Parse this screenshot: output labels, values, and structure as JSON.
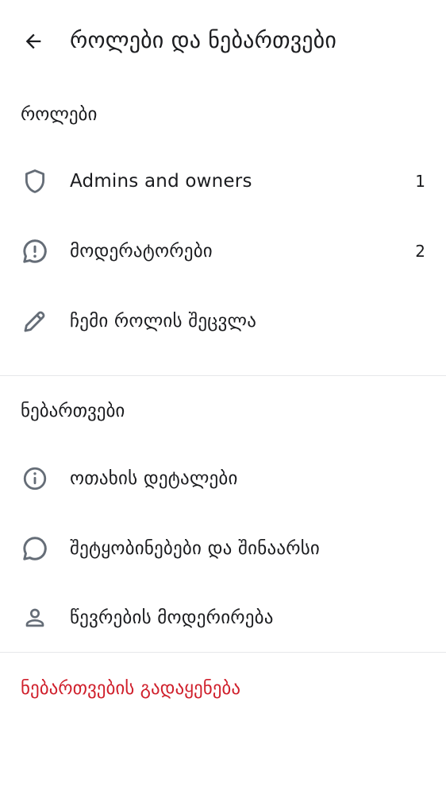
{
  "header": {
    "title": "როლები და ნებართვები",
    "back_icon": "arrow-left-icon"
  },
  "roles_section": {
    "title": "როლები",
    "items": [
      {
        "icon": "shield-icon",
        "label": "Admins and owners",
        "count": "1"
      },
      {
        "icon": "alert-chat-icon",
        "label": "მოდერატორები",
        "count": "2"
      },
      {
        "icon": "pencil-icon",
        "label": "ჩემი როლის შეცვლა"
      }
    ]
  },
  "permissions_section": {
    "title": "ნებართვები",
    "items": [
      {
        "icon": "info-icon",
        "label": "ოთახის დეტალები"
      },
      {
        "icon": "chat-bubble-icon",
        "label": "შეტყობინებები და შინაარსი"
      },
      {
        "icon": "person-icon",
        "label": "წევრების მოდერირება"
      }
    ]
  },
  "reset_label": "ნებართვების გადაყენება",
  "colors": {
    "text": "#1b1c1f",
    "icon": "#656d77",
    "danger": "#d0202c",
    "divider": "#e6e7ea"
  }
}
